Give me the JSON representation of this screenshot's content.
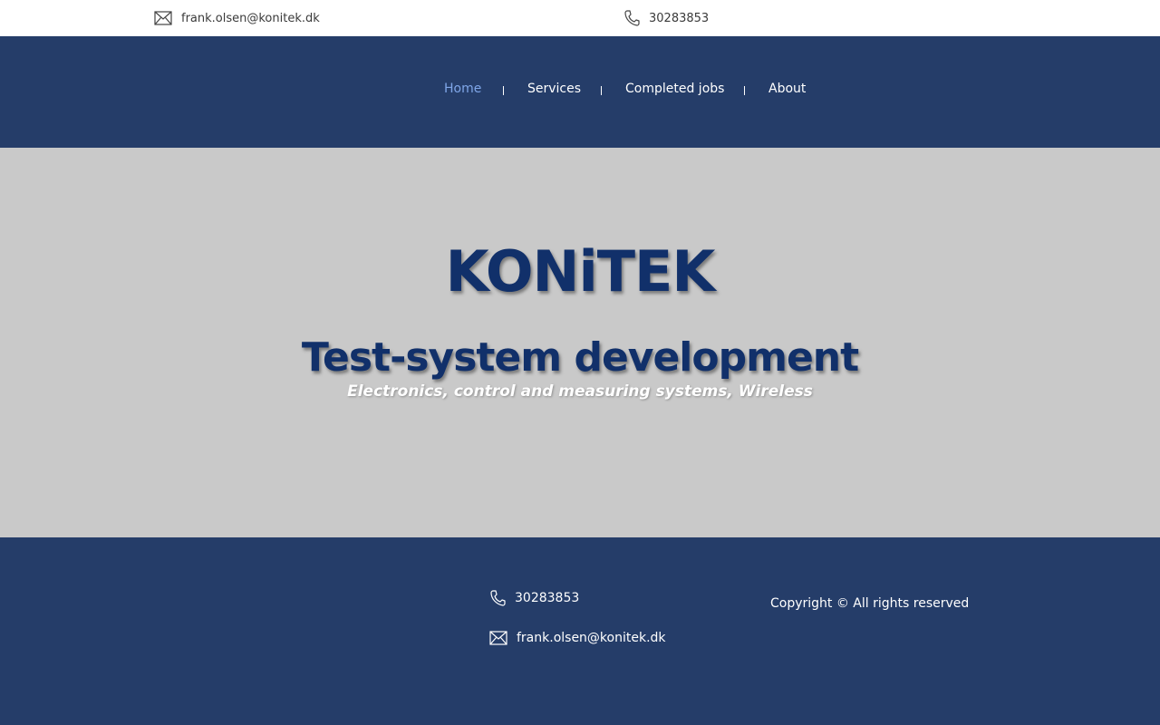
{
  "topbar": {
    "email": "frank.olsen@konitek.dk",
    "email_icon": "envelope-icon",
    "phone": "30283853",
    "phone_icon": "phone-icon"
  },
  "nav": {
    "items": [
      {
        "label": "Home",
        "active": true
      },
      {
        "label": "Services",
        "active": false
      },
      {
        "label": "Completed jobs",
        "active": false
      },
      {
        "label": "About",
        "active": false
      }
    ]
  },
  "hero": {
    "brand": "KONiTEK",
    "headline": "Test-system development",
    "tagline": "Electronics, control and measuring systems, Wireless"
  },
  "footer": {
    "phone": "30283853",
    "phone_icon": "phone-icon",
    "email": "frank.olsen@konitek.dk",
    "email_icon": "envelope-icon",
    "copyright": "Copyright © All rights reserved"
  },
  "colors": {
    "nav_background": "#253d69",
    "hero_background": "#c9c9c9",
    "brand_text": "#11306a",
    "active_nav": "#7fa6e8",
    "nav_text": "#ffffff"
  }
}
